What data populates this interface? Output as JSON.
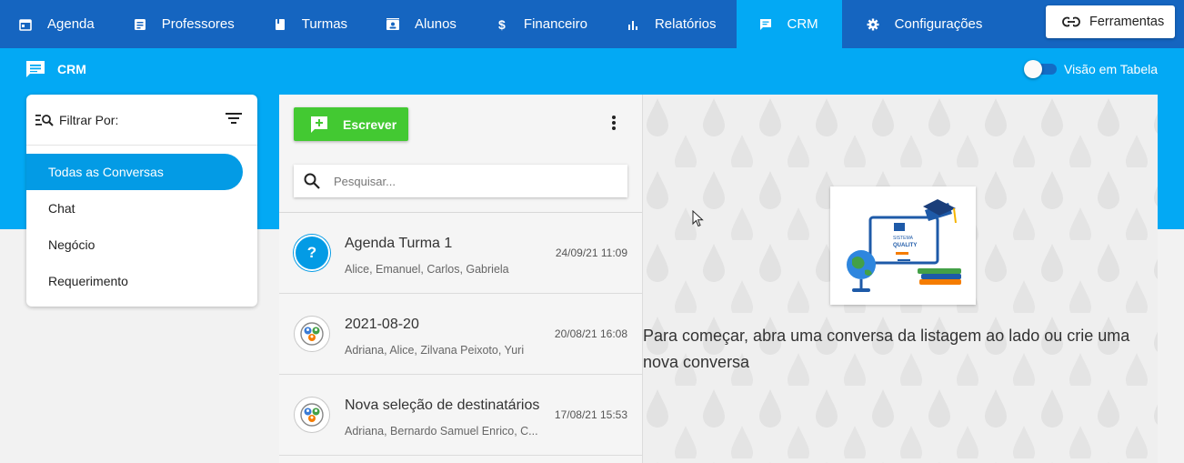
{
  "nav": {
    "items": [
      {
        "label": "Agenda",
        "icon": "calendar-icon"
      },
      {
        "label": "Professores",
        "icon": "badge-icon"
      },
      {
        "label": "Turmas",
        "icon": "book-icon"
      },
      {
        "label": "Alunos",
        "icon": "id-card-icon"
      },
      {
        "label": "Financeiro",
        "icon": "dollar-icon"
      },
      {
        "label": "Relatórios",
        "icon": "bar-chart-icon"
      },
      {
        "label": "CRM",
        "icon": "chat-icon",
        "active": true
      },
      {
        "label": "Configurações",
        "icon": "gear-icon"
      }
    ],
    "tools_label": "Ferramentas",
    "active_color": "#03a9f4",
    "bar_color": "#1565c0"
  },
  "header": {
    "title": "CRM",
    "toggle_label": "Visão em Tabela",
    "toggle_on": false
  },
  "filter": {
    "label": "Filtrar Por:",
    "items": [
      {
        "label": "Todas as Conversas",
        "active": true
      },
      {
        "label": "Chat"
      },
      {
        "label": "Negócio"
      },
      {
        "label": "Requerimento"
      }
    ]
  },
  "conversations": {
    "write_label": "Escrever",
    "search_placeholder": "Pesquisar...",
    "items": [
      {
        "title": "Agenda Turma 1",
        "participants": "Alice, Emanuel, Carlos, Gabriela",
        "date": "24/09/21 11:09",
        "avatar": "question-icon",
        "avatar_text": "?"
      },
      {
        "title": "2021-08-20",
        "participants": "Adriana, Alice, Zilvana Peixoto, Yuri",
        "date": "20/08/21 16:08",
        "avatar": "group-icon"
      },
      {
        "title": "Nova seleção de destinatários",
        "participants": "Adriana, Bernardo Samuel Enrico, C...",
        "date": "17/08/21 15:53",
        "avatar": "group-icon"
      }
    ]
  },
  "empty_state": {
    "message": "Para começar, abra uma conversa da listagem ao lado ou crie uma nova conversa",
    "logo_lines": [
      "SISTEMA",
      "QUALITY"
    ]
  }
}
